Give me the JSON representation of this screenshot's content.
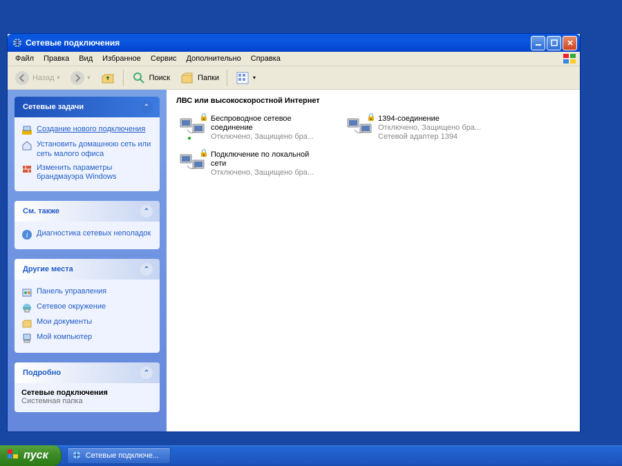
{
  "window": {
    "title": "Сетевые подключения",
    "buttons": {
      "min": "–",
      "max": "❐",
      "close": "✕"
    }
  },
  "menu": [
    "Файл",
    "Правка",
    "Вид",
    "Избранное",
    "Сервис",
    "Дополнительно",
    "Справка"
  ],
  "toolbar": {
    "back": "Назад",
    "search": "Поиск",
    "folders": "Папки"
  },
  "sidepanel": {
    "tasks": {
      "title": "Сетевые задачи",
      "items": [
        {
          "icon": "new-connection-icon",
          "text": "Создание нового подключения",
          "underline": true
        },
        {
          "icon": "home-network-icon",
          "text": "Установить домашнюю сеть или сеть малого офиса"
        },
        {
          "icon": "firewall-settings-icon",
          "text": "Изменить параметры брандмауэра Windows"
        }
      ]
    },
    "seealso": {
      "title": "См. также",
      "items": [
        {
          "icon": "info-icon",
          "text": "Диагностика сетевых неполадок"
        }
      ]
    },
    "otherplaces": {
      "title": "Другие места",
      "items": [
        {
          "icon": "control-panel-icon",
          "text": "Панель управления"
        },
        {
          "icon": "network-places-icon",
          "text": "Сетевое окружение"
        },
        {
          "icon": "my-documents-icon",
          "text": "Мои документы"
        },
        {
          "icon": "my-computer-icon",
          "text": "Мой компьютер"
        }
      ]
    },
    "details": {
      "title": "Подробно",
      "name": "Сетевые подключения",
      "type": "Системная папка"
    }
  },
  "content": {
    "group_title": "ЛВС или высокоскоростной Интернет",
    "connections": [
      {
        "name": "Беспроводное сетевое соединение",
        "status": "Отключено, Защищено бра...",
        "icon": "wifi-connection-icon",
        "lock": true,
        "dot": "green"
      },
      {
        "name": "1394-соединение",
        "status": "Отключено, Защищено бра...\nСетевой адаптер 1394",
        "icon": "firewire-connection-icon",
        "lock": true
      },
      {
        "name": "Подключение по локальной сети",
        "status": "Отключено, Защищено бра...",
        "icon": "lan-connection-icon",
        "lock": true
      }
    ]
  },
  "taskbar": {
    "start": "пуск",
    "items": [
      {
        "text": "Сетевые подключе..."
      }
    ]
  }
}
